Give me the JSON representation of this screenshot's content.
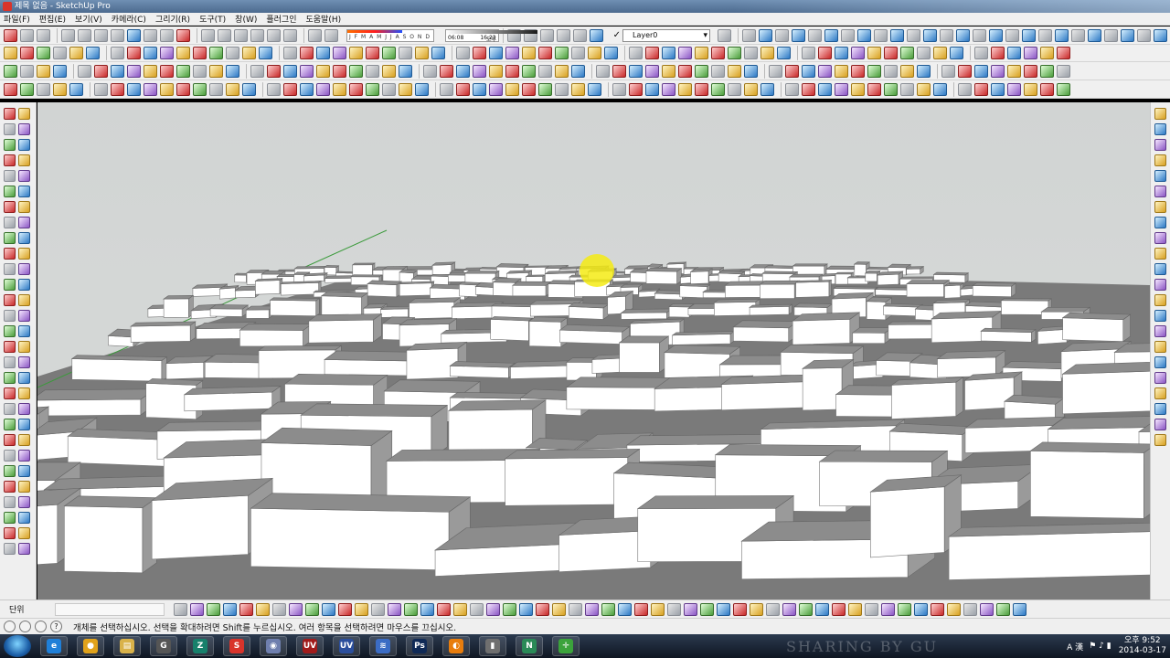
{
  "window": {
    "title": "제목 없음 - SketchUp Pro"
  },
  "menu": [
    "파일(F)",
    "편집(E)",
    "보기(V)",
    "카메라(C)",
    "그리기(R)",
    "도구(T)",
    "창(W)",
    "플러그인",
    "도움말(H)"
  ],
  "shadows": {
    "months": "J F M A M J J A S O N D",
    "time_start": "06:08",
    "time_mid": "오후",
    "time_end": "16:23"
  },
  "layer": {
    "current": "Layer0",
    "visible_check": "✓"
  },
  "measurements": {
    "label": "단위",
    "value": ""
  },
  "status": {
    "message": "개체를 선택하십시오. 선택을 확대하려면 Shift를 누르십시오. 여러 항목을 선택하려면 마우스를 끄십시오."
  },
  "taskbar": {
    "apps": [
      {
        "name": "internet-explorer",
        "glyph": "e",
        "color": "#1f7fd8"
      },
      {
        "name": "chrome",
        "glyph": "●",
        "color": "#e0a21b"
      },
      {
        "name": "file-explorer",
        "glyph": "▤",
        "color": "#d9b24a"
      },
      {
        "name": "app-g",
        "glyph": "G",
        "color": "#555555"
      },
      {
        "name": "app-z",
        "glyph": "Z",
        "color": "#17806b"
      },
      {
        "name": "sketchup",
        "glyph": "S",
        "color": "#d9342b"
      },
      {
        "name": "app-circle",
        "glyph": "◉",
        "color": "#6f7fae"
      },
      {
        "name": "app-uv",
        "glyph": "UV",
        "color": "#a11b1b"
      },
      {
        "name": "app-uv2",
        "glyph": "UV",
        "color": "#2b4e9c"
      },
      {
        "name": "app-wave",
        "glyph": "≋",
        "color": "#3b6cc4"
      },
      {
        "name": "photoshop",
        "glyph": "Ps",
        "color": "#102a56"
      },
      {
        "name": "blender",
        "glyph": "◐",
        "color": "#e87d0d"
      },
      {
        "name": "app-book",
        "glyph": "▮",
        "color": "#6f6f6f"
      },
      {
        "name": "app-n",
        "glyph": "N",
        "color": "#2a8a57"
      },
      {
        "name": "app-target",
        "glyph": "✛",
        "color": "#3ba33b"
      }
    ],
    "watermark": "SHARING BY GU",
    "tray_lang": "A 漢",
    "time": "오후 9:52",
    "date": "2014-03-17"
  },
  "colors": {
    "sky": "#d3d6d5",
    "ground": "#7a7a7a",
    "building_lit": "#ffffff",
    "building_side": "#9a9a9a",
    "building_roof": "#8c8c8c",
    "axis_green": "#3b9a3b",
    "cursor_highlight": "#f5eb14"
  }
}
